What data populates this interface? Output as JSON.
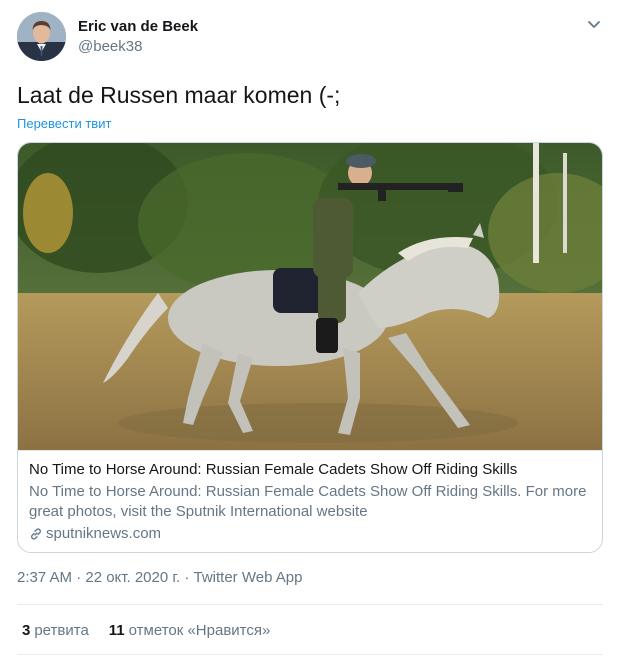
{
  "author": {
    "display_name": "Eric van de Beek",
    "handle": "@beek38"
  },
  "tweet": {
    "text": "Laat de Russen maar komen (-;",
    "translate_label": "Перевести твит"
  },
  "card": {
    "title": "No Time to Horse Around: Russian Female Cadets Show Off Riding Skills",
    "description": "No Time to Horse Around: Russian Female Cadets Show Off Riding Skills. For more great photos, visit the Sputnik International website",
    "domain": "sputniknews.com"
  },
  "meta": {
    "timestamp": "2:37 AM · 22 окт. 2020 г. · Twitter Web App"
  },
  "stats": {
    "retweets_count": "3",
    "retweets_label": "ретвита",
    "likes_count": "11",
    "likes_label": "отметок «Нравится»"
  },
  "colors": {
    "link": "#1b95e0",
    "secondary_text": "#657786",
    "border": "#ccd6dd"
  },
  "icons": {
    "caret": "chevron-down-icon",
    "link": "link-icon"
  }
}
